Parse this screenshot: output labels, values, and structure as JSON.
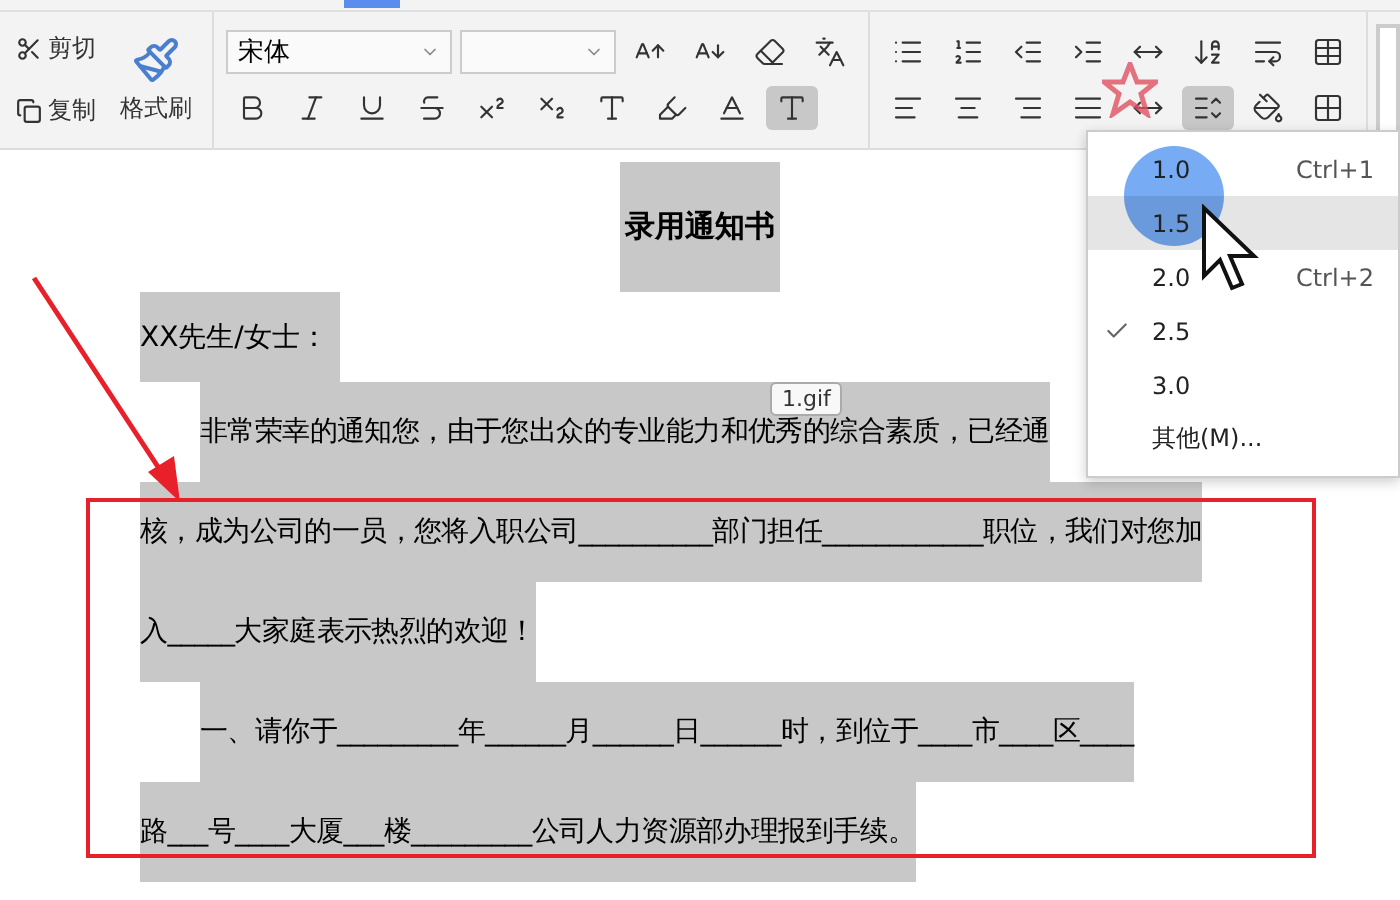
{
  "toolbar": {
    "clipboard": {
      "cut": "剪切",
      "copy": "复制",
      "format_painter": "格式刷"
    },
    "font_name": "宋体",
    "line_spacing_pressed": true
  },
  "document": {
    "title": "录用通知书",
    "salutation": "XX先生/女士：",
    "lines": [
      {
        "text": "非常荣幸的通知您，由于您出众的专业能力和优秀的综合素质，已经通",
        "indent": true
      },
      {
        "text": "核，成为公司的一员，您将入职公司__________部门担任____________职位，我们对您加",
        "indent": false
      },
      {
        "text": "入_____大家庭表示热烈的欢迎！",
        "indent": false
      },
      {
        "text": "一、请你于_________年______月______日______时，到位于____市____区____",
        "indent": true
      },
      {
        "text": "路___号____大厦___楼_________公司人力资源部办理报到手续。",
        "indent": false
      }
    ],
    "image_tag": "1.gif"
  },
  "line_spacing_menu": [
    {
      "label": "1.0",
      "shortcut": "Ctrl+1",
      "checked": false,
      "selected": false
    },
    {
      "label": "1.5",
      "checked": false,
      "selected": true
    },
    {
      "label": "2.0",
      "shortcut": "Ctrl+2",
      "checked": false,
      "selected": false
    },
    {
      "label": "2.5",
      "checked": true,
      "selected": false
    },
    {
      "label": "3.0",
      "checked": false,
      "selected": false
    },
    {
      "label": "其他(M)...",
      "checked": false,
      "selected": false
    }
  ]
}
